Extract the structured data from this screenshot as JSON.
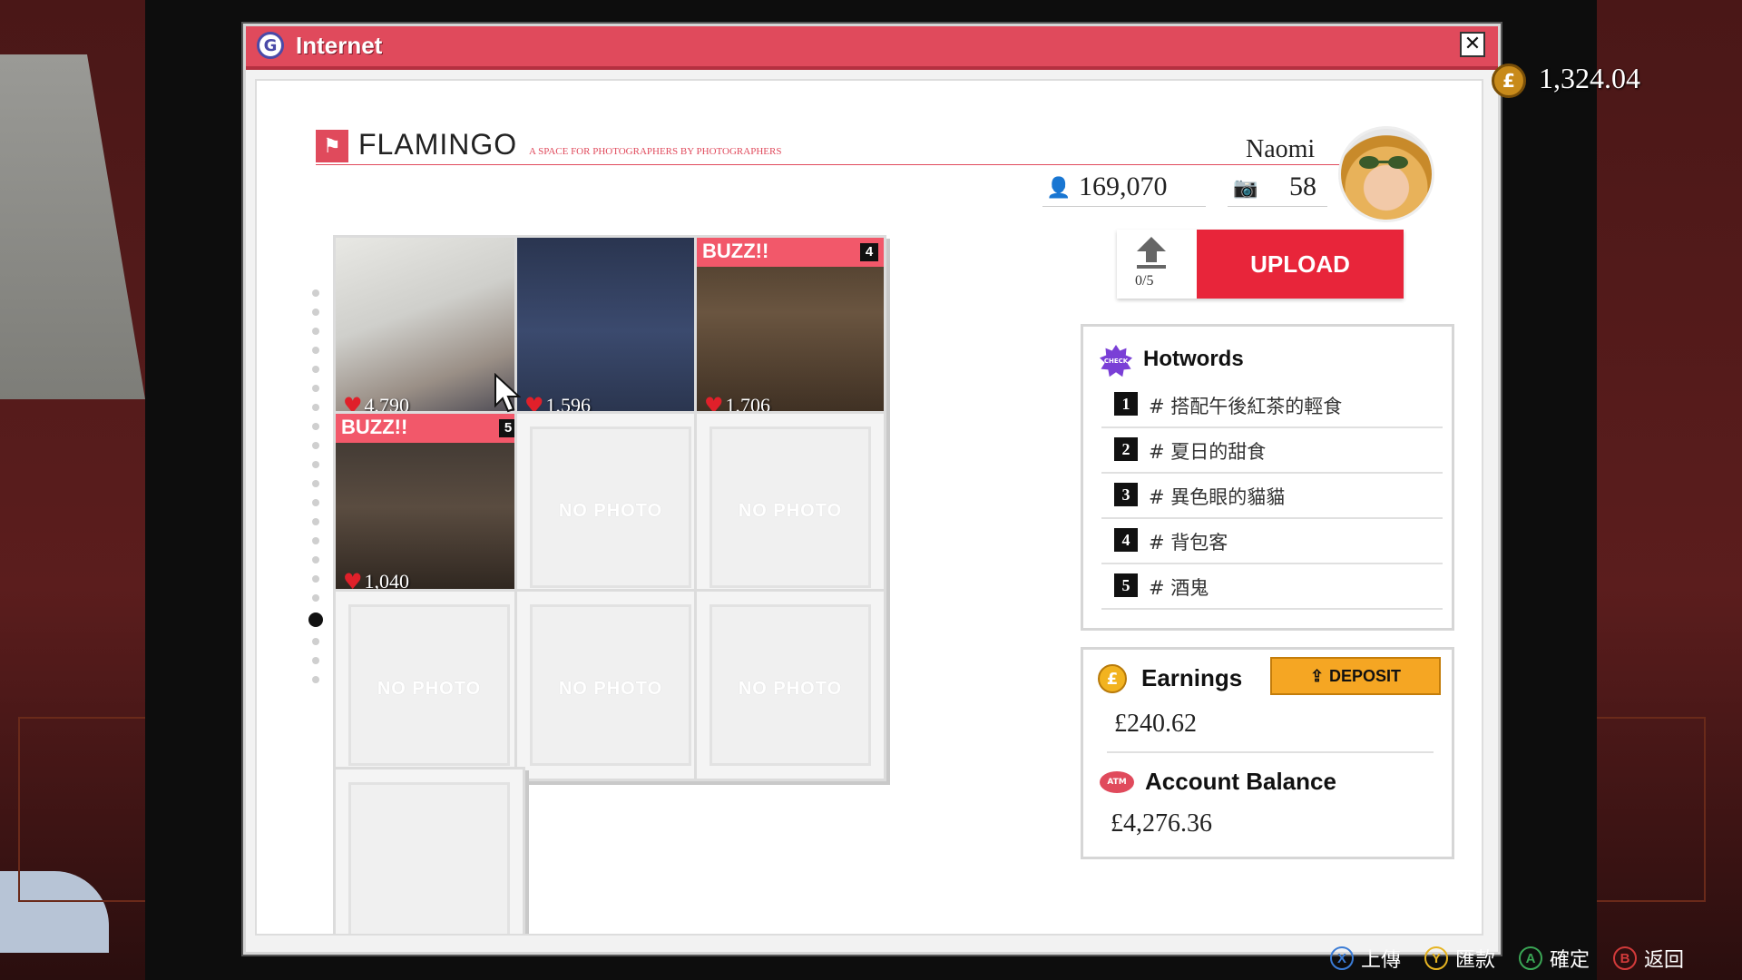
{
  "window": {
    "title": "Internet"
  },
  "site": {
    "name": "FLAMINGO",
    "tagline": "A SPACE FOR PHOTOGRAPHERS BY PHOTOGRAPHERS"
  },
  "profile": {
    "name": "Naomi",
    "followers": "169,070",
    "photos": "58"
  },
  "hud": {
    "money": "1,324.04"
  },
  "grid": {
    "no_photo": "NO PHOTO",
    "buzz_label": "BUZZ!!",
    "photos": [
      {
        "likes": "4,790",
        "buzz": false
      },
      {
        "likes": "1,596",
        "buzz": false
      },
      {
        "likes": "1,706",
        "buzz": true,
        "rank": "4"
      },
      {
        "likes": "1,040",
        "buzz": true,
        "rank": "5"
      }
    ]
  },
  "upload": {
    "label": "UPLOAD",
    "count": "0/5"
  },
  "hotwords": {
    "title": "Hotwords",
    "badge": "CHECK",
    "items": [
      {
        "rank": "1",
        "tag": "# 搭配午後紅茶的輕食"
      },
      {
        "rank": "2",
        "tag": "# 夏日的甜食"
      },
      {
        "rank": "3",
        "tag": "# 異色眼的貓貓"
      },
      {
        "rank": "4",
        "tag": "# 背包客"
      },
      {
        "rank": "5",
        "tag": "# 酒鬼"
      }
    ]
  },
  "earnings": {
    "title": "Earnings",
    "value": "£240.62",
    "deposit_label": "DEPOSIT"
  },
  "balance": {
    "title": "Account Balance",
    "value": "£4,276.36",
    "icon_text": "ATM"
  },
  "hints": [
    {
      "button": "X",
      "label": "上傳",
      "color": "#3a7bd5"
    },
    {
      "button": "Y",
      "label": "匯款",
      "color": "#e6b422"
    },
    {
      "button": "A",
      "label": "確定",
      "color": "#3aa655"
    },
    {
      "button": "B",
      "label": "返回",
      "color": "#d23a3a"
    }
  ],
  "colors": {
    "accent": "#e04a5c",
    "upload": "#e8253a",
    "deposit": "#f5a623"
  },
  "icons": [
    "internet-icon",
    "close-icon",
    "flamingo-icon",
    "followers-icon",
    "camera-icon",
    "upload-arrow-icon",
    "hotwords-check-icon",
    "pound-coin-icon",
    "atm-icon",
    "heart-icon",
    "cursor-icon"
  ]
}
